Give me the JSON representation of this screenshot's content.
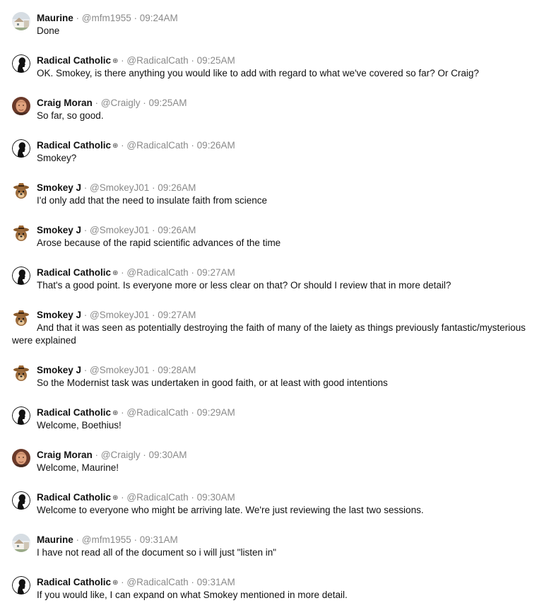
{
  "messages": [
    {
      "name": "Maurine",
      "handle": "@mfm1955",
      "time": "09:24AM",
      "text": "Done",
      "avatar": "house-photo-avatar",
      "badge": ""
    },
    {
      "name": "Radical Catholic",
      "handle": "@RadicalCath",
      "time": "09:25AM",
      "text": "OK. Smokey, is there anything you would like to add with regard to what we've covered so far? Or Craig?",
      "avatar": "silhouette-avatar",
      "badge": "⊕"
    },
    {
      "name": "Craig Moran",
      "handle": "@Craigly",
      "time": "09:25AM",
      "text": "So far, so good.",
      "avatar": "portrait-avatar",
      "badge": ""
    },
    {
      "name": "Radical Catholic",
      "handle": "@RadicalCath",
      "time": "09:26AM",
      "text": "Smokey?",
      "avatar": "silhouette-avatar",
      "badge": "⊕"
    },
    {
      "name": "Smokey J",
      "handle": "@SmokeyJ01",
      "time": "09:26AM",
      "text": "I'd only add that the need to insulate faith from science",
      "avatar": "bear-avatar",
      "badge": ""
    },
    {
      "name": "Smokey J",
      "handle": "@SmokeyJ01",
      "time": "09:26AM",
      "text": "Arose because of the rapid scientific advances of the time",
      "avatar": "bear-avatar",
      "badge": ""
    },
    {
      "name": "Radical Catholic",
      "handle": "@RadicalCath",
      "time": "09:27AM",
      "text": "That's a good point. Is everyone more or less clear on that? Or should I review that in more detail?",
      "avatar": "silhouette-avatar",
      "badge": "⊕"
    },
    {
      "name": "Smokey J",
      "handle": "@SmokeyJ01",
      "time": "09:27AM",
      "text": "And that it was seen as potentially destroying the faith of many of the laiety as things previously fantastic/mysterious were explained",
      "avatar": "bear-avatar",
      "badge": ""
    },
    {
      "name": "Smokey J",
      "handle": "@SmokeyJ01",
      "time": "09:28AM",
      "text": "So the Modernist task was undertaken in good faith, or at least with good intentions",
      "avatar": "bear-avatar",
      "badge": ""
    },
    {
      "name": "Radical Catholic",
      "handle": "@RadicalCath",
      "time": "09:29AM",
      "text": "Welcome, Boethius!",
      "avatar": "silhouette-avatar",
      "badge": "⊕"
    },
    {
      "name": "Craig Moran",
      "handle": "@Craigly",
      "time": "09:30AM",
      "text": "Welcome, Maurine!",
      "avatar": "portrait-avatar",
      "badge": ""
    },
    {
      "name": "Radical Catholic",
      "handle": "@RadicalCath",
      "time": "09:30AM",
      "text": "Welcome to everyone who might be arriving late. We're just reviewing the last two sessions.",
      "avatar": "silhouette-avatar",
      "badge": "⊕"
    },
    {
      "name": "Maurine",
      "handle": "@mfm1955",
      "time": "09:31AM",
      "text": "I have not read all of the document so i will just \"listen in\"",
      "avatar": "house-photo-avatar",
      "badge": ""
    },
    {
      "name": "Radical Catholic",
      "handle": "@RadicalCath",
      "time": "09:31AM",
      "text": "If you would like, I can expand on what Smokey mentioned in more detail.",
      "avatar": "silhouette-avatar",
      "badge": "⊕"
    }
  ]
}
